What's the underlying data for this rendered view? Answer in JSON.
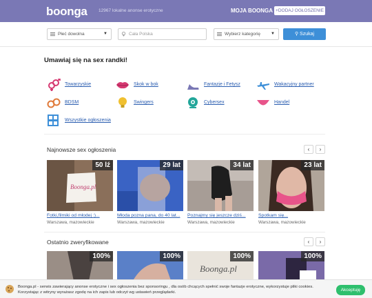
{
  "header": {
    "logo": "boonga",
    "tagline": "12967 lokalne anonse erotyczne",
    "account_link": "MOJA BOONGA",
    "add_button": "+DODAJ OGŁOSZENIE"
  },
  "search": {
    "gender_select": "Płeć dowolna",
    "city_placeholder": "Cała Polska",
    "category_select": "Wybierz kategorię",
    "submit": "Szukaj"
  },
  "intro_heading": "Umawiaj się na sex randki!",
  "categories": [
    {
      "label": "Towarzyskie",
      "icon": "gender-symbols-icon"
    },
    {
      "label": "Skok w bok",
      "icon": "lips-icon"
    },
    {
      "label": "Fantazje i Fetysz",
      "icon": "high-heel-icon"
    },
    {
      "label": "Wakacyjny partner",
      "icon": "airplane-icon"
    },
    {
      "label": "BDSM",
      "icon": "handcuffs-icon"
    },
    {
      "label": "Swingers",
      "icon": "lightbulb-icon"
    },
    {
      "label": "Cybersex",
      "icon": "webcam-icon"
    },
    {
      "label": "Handel",
      "icon": "lingerie-icon"
    },
    {
      "label": "Wszystkie ogłoszenia",
      "icon": "grid-icon"
    }
  ],
  "newest": {
    "title": "Najnowsze sex ogłoszenia",
    "prev": "‹",
    "next": "›",
    "cards": [
      {
        "age": "50 lź",
        "title": "Fotki,filmiki od młodej :)...",
        "location": "Warszawa, mazowieckie"
      },
      {
        "age": "29 lat",
        "title": "Młoda pozna pana, do 40 lat...",
        "location": "Warszawa, mazowieckie"
      },
      {
        "age": "34 lat",
        "title": "Poznajmy się jeszcze dziś...",
        "location": "Warszawa, mazowieckie"
      },
      {
        "age": "23 lat",
        "title": "Spotkam się...",
        "location": "Warszawa, mazowieckie"
      }
    ]
  },
  "verified": {
    "title": "Ostatnio zweryfikowane",
    "prev": "‹",
    "next": "›",
    "cards": [
      {
        "badge": "100%",
        "sign": ""
      },
      {
        "badge": "100%",
        "sign": ""
      },
      {
        "badge": "100%",
        "sign": "Boonga.pl"
      },
      {
        "badge": "100%",
        "sign": ""
      }
    ]
  },
  "cookie": {
    "text": "Boonga.pl - serwis zawierający anonse erotyczne i sex ogłoszenia bez sponsoringu , dla osób chcących spełnić swoje fantazje erotyczne, wykorzystuje pliki cookies. Korzystając z witryny wyrażasz zgodę na ich zapis lub odczyt wg ustawień przeglądarki.",
    "accept": "Akceptuję"
  },
  "colors": {
    "header": "#7a78b5",
    "link": "#2a5db0",
    "search_button": "#3d8fd8",
    "accept": "#2ebf6d"
  }
}
